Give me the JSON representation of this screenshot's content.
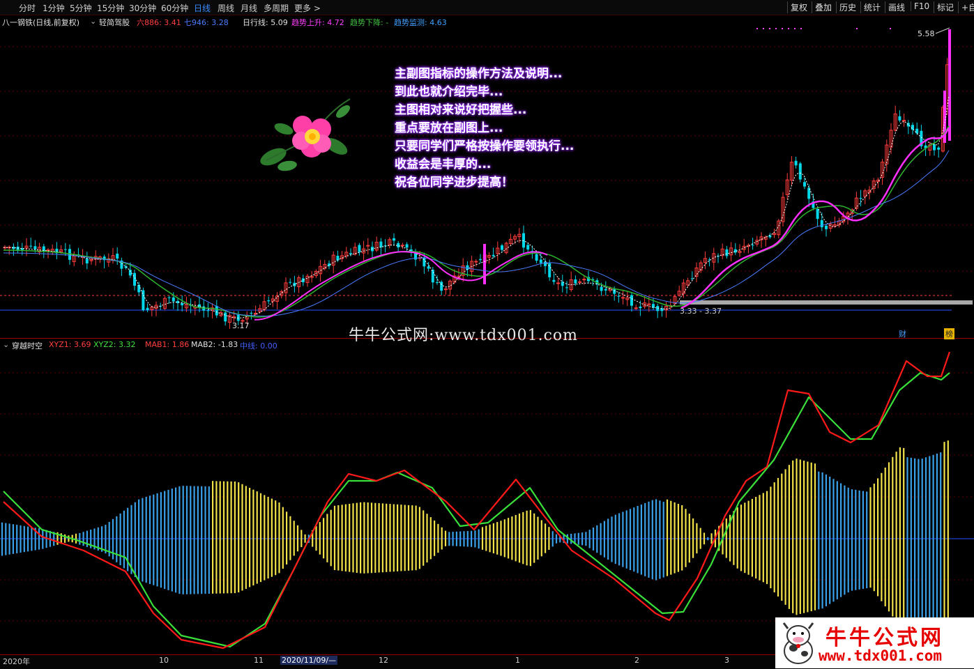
{
  "toolbar": {
    "periods": [
      "分时",
      "1分钟",
      "5分钟",
      "15分钟",
      "30分钟",
      "60分钟",
      "日线",
      "周线",
      "月线",
      "多周期",
      "更多 >"
    ],
    "active_period": "日线",
    "right_buttons": [
      "复权",
      "叠加",
      "历史",
      "统计",
      "画线",
      "F10",
      "标记",
      "+自选"
    ]
  },
  "main_info": {
    "stock": "八一钢铁(日线,前复权)",
    "indicator": "轻简驾股",
    "items": [
      {
        "label": "六886: 3.41",
        "color": "#ff4040"
      },
      {
        "label": "七946: 3.28",
        "color": "#4a7cff"
      },
      {
        "label": "日行线: 5.09",
        "color": "#e0e0e0"
      },
      {
        "label": "趋势上升: 4.72",
        "color": "#ff40ff"
      },
      {
        "label": "趋势下降: -",
        "color": "#40c040"
      },
      {
        "label": "趋势监测: 4.63",
        "color": "#40a0ff"
      }
    ]
  },
  "sub_info": {
    "indicator": "穿越时空",
    "items": [
      {
        "label": "XYZ1: 3.69",
        "color": "#ff4040"
      },
      {
        "label": "XYZ2: 3.32",
        "color": "#40e040"
      },
      {
        "label": "MAB1: 1.86",
        "color": "#ff4040"
      },
      {
        "label": "MAB2: -1.83",
        "color": "#e0e0e0"
      },
      {
        "label": "中线: 0.00",
        "color": "#4060ff"
      }
    ]
  },
  "price_labels": {
    "high": "5.58",
    "low": "3.17",
    "range": "3.33 - 3.37"
  },
  "tags": {
    "cai": "财",
    "bang": "榜"
  },
  "overlay_text": [
    "主副图指标的操作方法及说明...",
    "到此也就介绍完毕...",
    "主图相对来说好把握些...",
    "重点要放在副图上...",
    "只要同学们严格按操作要领执行...",
    "收益会是丰厚的...",
    "祝各位同学进步提高！"
  ],
  "watermark": "牛牛公式网:www.tdx001.com",
  "x_axis": [
    "2020年",
    "10",
    "11",
    "2020/11/09/—",
    "12",
    "1",
    "2",
    "3"
  ],
  "logo": {
    "cn": "牛牛公式网",
    "url": "www.tdx001.com"
  },
  "colors": {
    "up": "#ff3c3c",
    "down": "#00d7e8",
    "ma_white": "#ffffff",
    "ma_magenta": "#ff30ff",
    "ma_green": "#2fb32f",
    "ma_blue": "#4a7cff",
    "bar_blue": "#3aa0e8",
    "bar_yellow": "#f2e24a",
    "line_red": "#ff1a1a",
    "line_green": "#3ae03a"
  },
  "chart_data": {
    "type": "candlestick+lines+histogram",
    "price_range": [
      3.17,
      5.58
    ],
    "series": [
      {
        "name": "XYZ1",
        "last": 3.69
      },
      {
        "name": "XYZ2",
        "last": 3.32
      },
      {
        "name": "MAB1",
        "last": 1.86
      },
      {
        "name": "MAB2",
        "last": -1.83
      },
      {
        "name": "中线",
        "last": 0.0
      }
    ]
  }
}
